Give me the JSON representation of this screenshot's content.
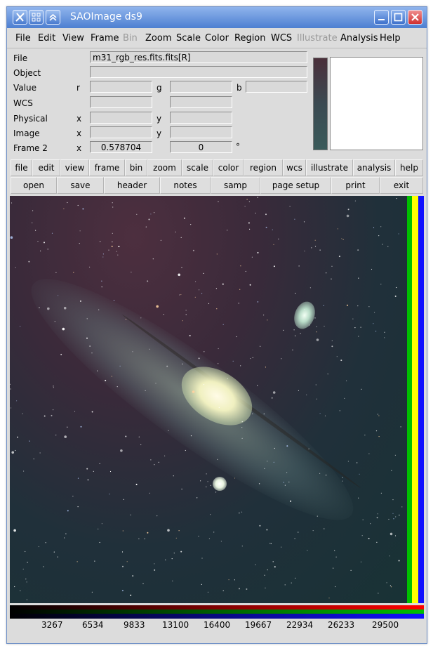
{
  "window": {
    "title": "SAOImage ds9"
  },
  "menubar": {
    "items": [
      "File",
      "Edit",
      "View",
      "Frame",
      "Bin",
      "Zoom",
      "Scale",
      "Color",
      "Region",
      "WCS",
      "Illustrate",
      "Analysis",
      "Help"
    ],
    "disabled": [
      "Bin",
      "Illustrate"
    ]
  },
  "info": {
    "file_label": "File",
    "file_value": "m31_rgb_res.fits.fits[R]",
    "object_label": "Object",
    "object_value": "",
    "value_label": "Value",
    "value_r_label": "r",
    "value_g_label": "g",
    "value_b_label": "b",
    "value_r": "",
    "value_g": "",
    "value_b": "",
    "wcs_label": "WCS",
    "wcs_1": "",
    "wcs_2": "",
    "physical_label": "Physical",
    "physical_x_label": "x",
    "physical_y_label": "y",
    "physical_x": "",
    "physical_y": "",
    "image_label": "Image",
    "image_x_label": "x",
    "image_y_label": "y",
    "image_x": "",
    "image_y": "",
    "frame_label": "Frame 2",
    "frame_x_label": "x",
    "frame_zoom": "0.578704",
    "frame_angle": "0",
    "frame_angle_unit": "°"
  },
  "buttonbar_main": [
    "file",
    "edit",
    "view",
    "frame",
    "bin",
    "zoom",
    "scale",
    "color",
    "region",
    "wcs",
    "illustrate",
    "analysis",
    "help"
  ],
  "buttonbar_sub": [
    "open",
    "save",
    "header",
    "notes",
    "samp",
    "page setup",
    "print",
    "exit"
  ],
  "colorbar": {
    "ticks": [
      "3267",
      "6534",
      "9833",
      "13100",
      "16400",
      "19667",
      "22934",
      "26233",
      "29500"
    ],
    "colors": {
      "red": "#ff0000",
      "green": "#00c000",
      "blue": "#1010ff",
      "yellow": "#ffff00"
    }
  },
  "icons": {
    "app": "x-logo-icon",
    "titlebar_grid": "grid-icon",
    "titlebar_up": "chevron-up-icon",
    "minimize": "minimize-icon",
    "maximize": "maximize-icon",
    "close": "close-icon"
  }
}
